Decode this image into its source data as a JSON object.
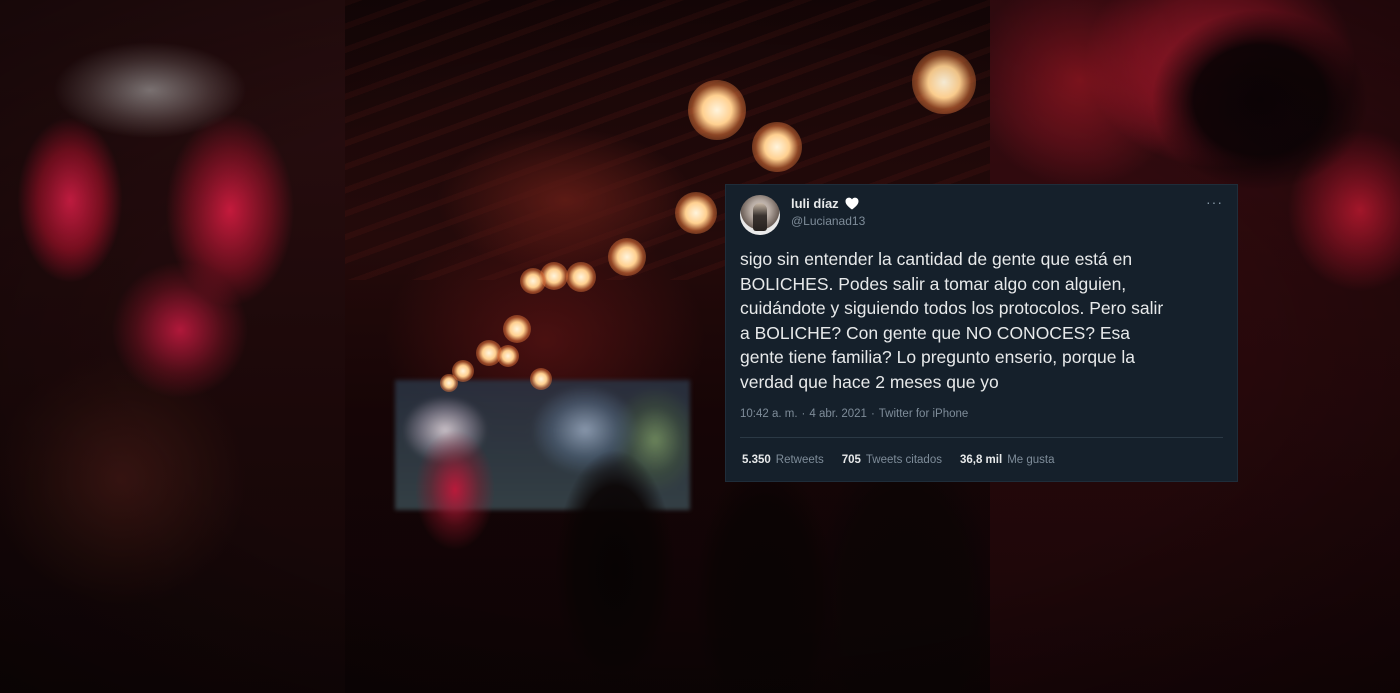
{
  "tweet": {
    "display_name": "luli díaz",
    "handle": "@Lucianad13",
    "text": "sigo sin entender la cantidad de gente que está en\nBOLICHES. Podes salir a tomar algo con alguien,\ncuidándote y siguiendo todos los protocolos. Pero salir\na BOLICHE? Con gente que NO CONOCES? Esa\ngente tiene familia? Lo pregunto enserio, porque la\nverdad que hace 2 meses que yo",
    "time": "10:42 a. m.",
    "separator": "·",
    "date": "4 abr. 2021",
    "source": "Twitter for iPhone",
    "more_glyph": "···",
    "stats": {
      "retweets_count": "5.350",
      "retweets_label": "Retweets",
      "quotes_count": "705",
      "quotes_label": "Tweets citados",
      "likes_count": "36,8 mil",
      "likes_label": "Me gusta"
    }
  },
  "colors": {
    "card_bg": "#15202b",
    "text_primary": "#e7e9ea",
    "text_secondary": "#7e8c99"
  },
  "icons": {
    "name_emoji": "white-heart-icon",
    "menu": "more-options-icon"
  }
}
